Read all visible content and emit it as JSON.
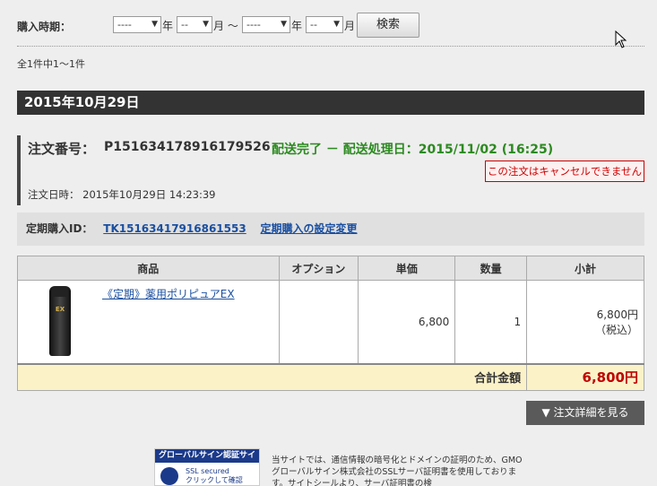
{
  "filter": {
    "label": "購入時期：",
    "year_from": "----",
    "month_from": "--",
    "year_to": "----",
    "month_to": "--",
    "unit_year": "年",
    "unit_month": "月",
    "range_sep": "月 〜",
    "search_label": "検索"
  },
  "result_count": "全1件中1〜1件",
  "date_header": "2015年10月29日",
  "order": {
    "number_label": "注文番号：",
    "number": "P151634178916179526",
    "status": "配送完了 － 配送処理日：2015/11/02 (16:25)",
    "cancel_note": "この注文はキャンセルできません",
    "order_date": "注文日時： 2015年10月29日 14:23:39"
  },
  "subscription": {
    "label": "定期購入ID：",
    "id": "TK15163417916861553",
    "change_link": "定期購入の設定変更"
  },
  "table": {
    "headers": [
      "商品",
      "オプション",
      "単価",
      "数量",
      "小計"
    ],
    "rows": [
      {
        "product": "《定期》薬用ポリピュアEX",
        "option": "",
        "unit_price": "6,800",
        "quantity": "1",
        "subtotal": "6,800円",
        "tax_note": "（税込）"
      }
    ],
    "total_label": "合計金額",
    "total_value": "6,800円"
  },
  "detail_button": "▼ 注文詳細を見る",
  "footer": {
    "seal_title": "グローバルサイン認証サイト",
    "seal_line1": "SSL secured",
    "seal_line2": "クリックして確認",
    "text": "当サイトでは、通信情報の暗号化とドメインの証明のため、GMOグローバルサイン株式会社のSSLサーバ証明書を使用しております。サイトシールより、サーバ証明書の検"
  },
  "colors": {
    "status_green": "#2b8a1f",
    "cancel_red": "#cc0000",
    "total_red": "#c00000",
    "link_blue": "#1a4fa0",
    "header_dark": "#333333"
  }
}
